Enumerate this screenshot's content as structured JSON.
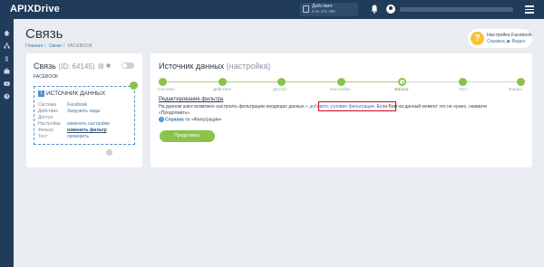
{
  "header": {
    "logo_api": "API",
    "logo_x": "X",
    "logo_drive": "Drive",
    "notice_title": "Действия:",
    "notice_value": "0 из 101 296"
  },
  "page": {
    "title": "Связь",
    "breadcrumbs": [
      "Главная",
      "Связи",
      "FACEBOOK"
    ],
    "breadcrumb_sep": "/"
  },
  "help": {
    "title": "Настройка Facebook",
    "links": "Справка, ▶ Видео"
  },
  "connection": {
    "label": "Связь",
    "id_text": "(ID: 64145)",
    "subtitle": "FACEBOOK",
    "source_num": "1",
    "source_title": "ИСТОЧНИК ДАННЫХ",
    "rows": [
      {
        "key": "Система",
        "value": "Facebook"
      },
      {
        "key": "Действие",
        "value": "Загрузить лиды"
      },
      {
        "key": "Доступ",
        "value": ""
      },
      {
        "key": "Настройки",
        "value": "изменить настройки"
      },
      {
        "key": "Фильтр",
        "value": "изменить фильтр"
      },
      {
        "key": "Тест",
        "value": "проверить"
      }
    ]
  },
  "source_panel": {
    "title": "Источник данных",
    "subtitle": "(настройка)",
    "steps": [
      "Система",
      "Действие",
      "Доступ",
      "Настройки",
      "Фильтр",
      "Тест",
      "Финиш"
    ],
    "current_step": "Фильтр",
    "edit_title": "Редактирование фильтра",
    "desc_before": "На данном шаге возможно настроить фильтрацию входящих данных.",
    "desc_link": "+ добавить условие фильтрации",
    "desc_after": ". Если Вам на данный момент это не нужно, нажмите",
    "desc_line2": "«Продолжить».",
    "help_prefix": "Справка",
    "help_mid": "по",
    "help_link": "«Фильтрации»",
    "continue_label": "Продолжить"
  },
  "colors": {
    "accent_green": "#8bc34a",
    "nav_dark": "#203c5a",
    "link_blue": "#3a79b5",
    "highlight_red": "#d0021b"
  }
}
